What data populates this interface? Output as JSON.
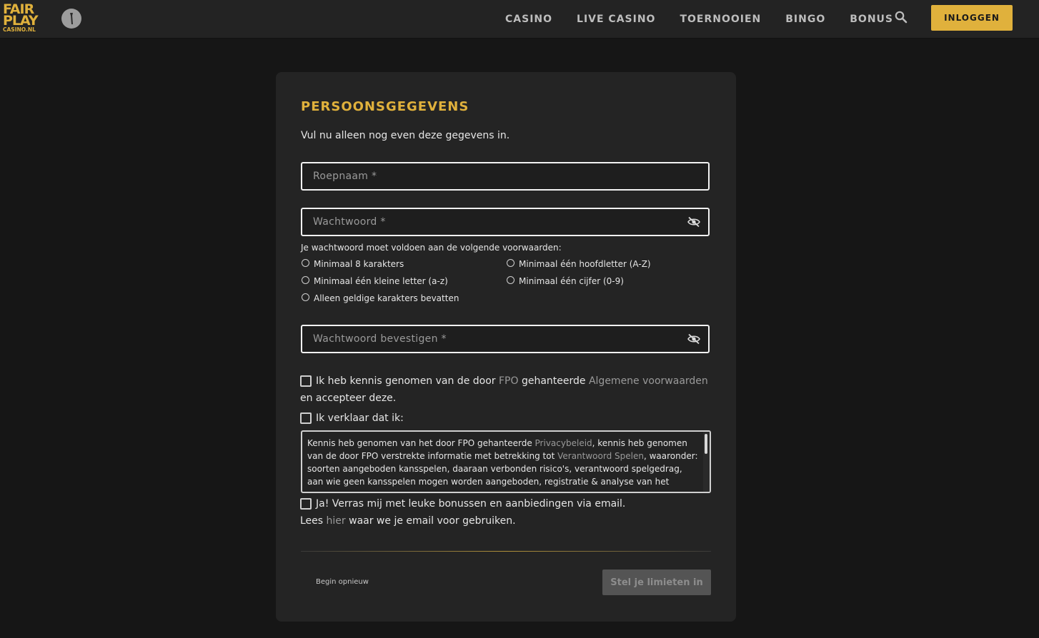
{
  "header": {
    "logo": {
      "line1": "FAIR",
      "line2": "PLAY",
      "line3": "CASINO.NL"
    },
    "nav": [
      "CASINO",
      "LIVE CASINO",
      "TOERNOOIEN",
      "BINGO",
      "BONUS"
    ],
    "login_label": "INLOGGEN",
    "brand_color": "#e0b13c"
  },
  "form": {
    "title": "PERSOONSGEGEVENS",
    "subtitle": "Vul nu alleen nog even deze gegevens in.",
    "nickname": {
      "placeholder": "Roepnaam *",
      "value": ""
    },
    "password": {
      "placeholder": "Wachtwoord *",
      "value": ""
    },
    "password_confirm": {
      "placeholder": "Wachtwoord bevestigen *",
      "value": ""
    },
    "rules_title": "Je wachtwoord moet voldoen aan de volgende voorwaarden:",
    "rules": [
      "Minimaal 8 karakters",
      "Minimaal één hoofdletter (A-Z)",
      "Minimaal één kleine letter (a-z)",
      "Minimaal één cijfer (0-9)",
      "Alleen geldige karakters bevatten"
    ],
    "terms": {
      "part1": "Ik heb kennis genomen van de door ",
      "link1": "FPO",
      "part2": " gehanteerde ",
      "link2": "Algemene voorwaarden",
      "part3": "en accepteer deze."
    },
    "declare_label": "Ik verklaar dat ik:",
    "declaration": {
      "part1": "Kennis heb genomen van het door FPO gehanteerde ",
      "link1": "Privacybeleid",
      "part2": ", kennis heb genomen van de door FPO verstrekte informatie met betrekking tot ",
      "link2": "Verantwoord Spelen",
      "part3": ", waaronder: soorten aangeboden kansspelen, daaraan verbonden risico's, verantwoord spelgedrag, aan wie geen kansspelen mogen worden aangeboden, registratie & analyse van het"
    },
    "newsletter": {
      "label": "Ja! Verras mij met leuke bonussen en aanbiedingen via email.",
      "read_pre": "Lees ",
      "read_link": "hier",
      "read_post": " waar we je email voor gebruiken."
    },
    "restart_label": "Begin opnieuw",
    "submit_label": "Stel je limieten in"
  }
}
